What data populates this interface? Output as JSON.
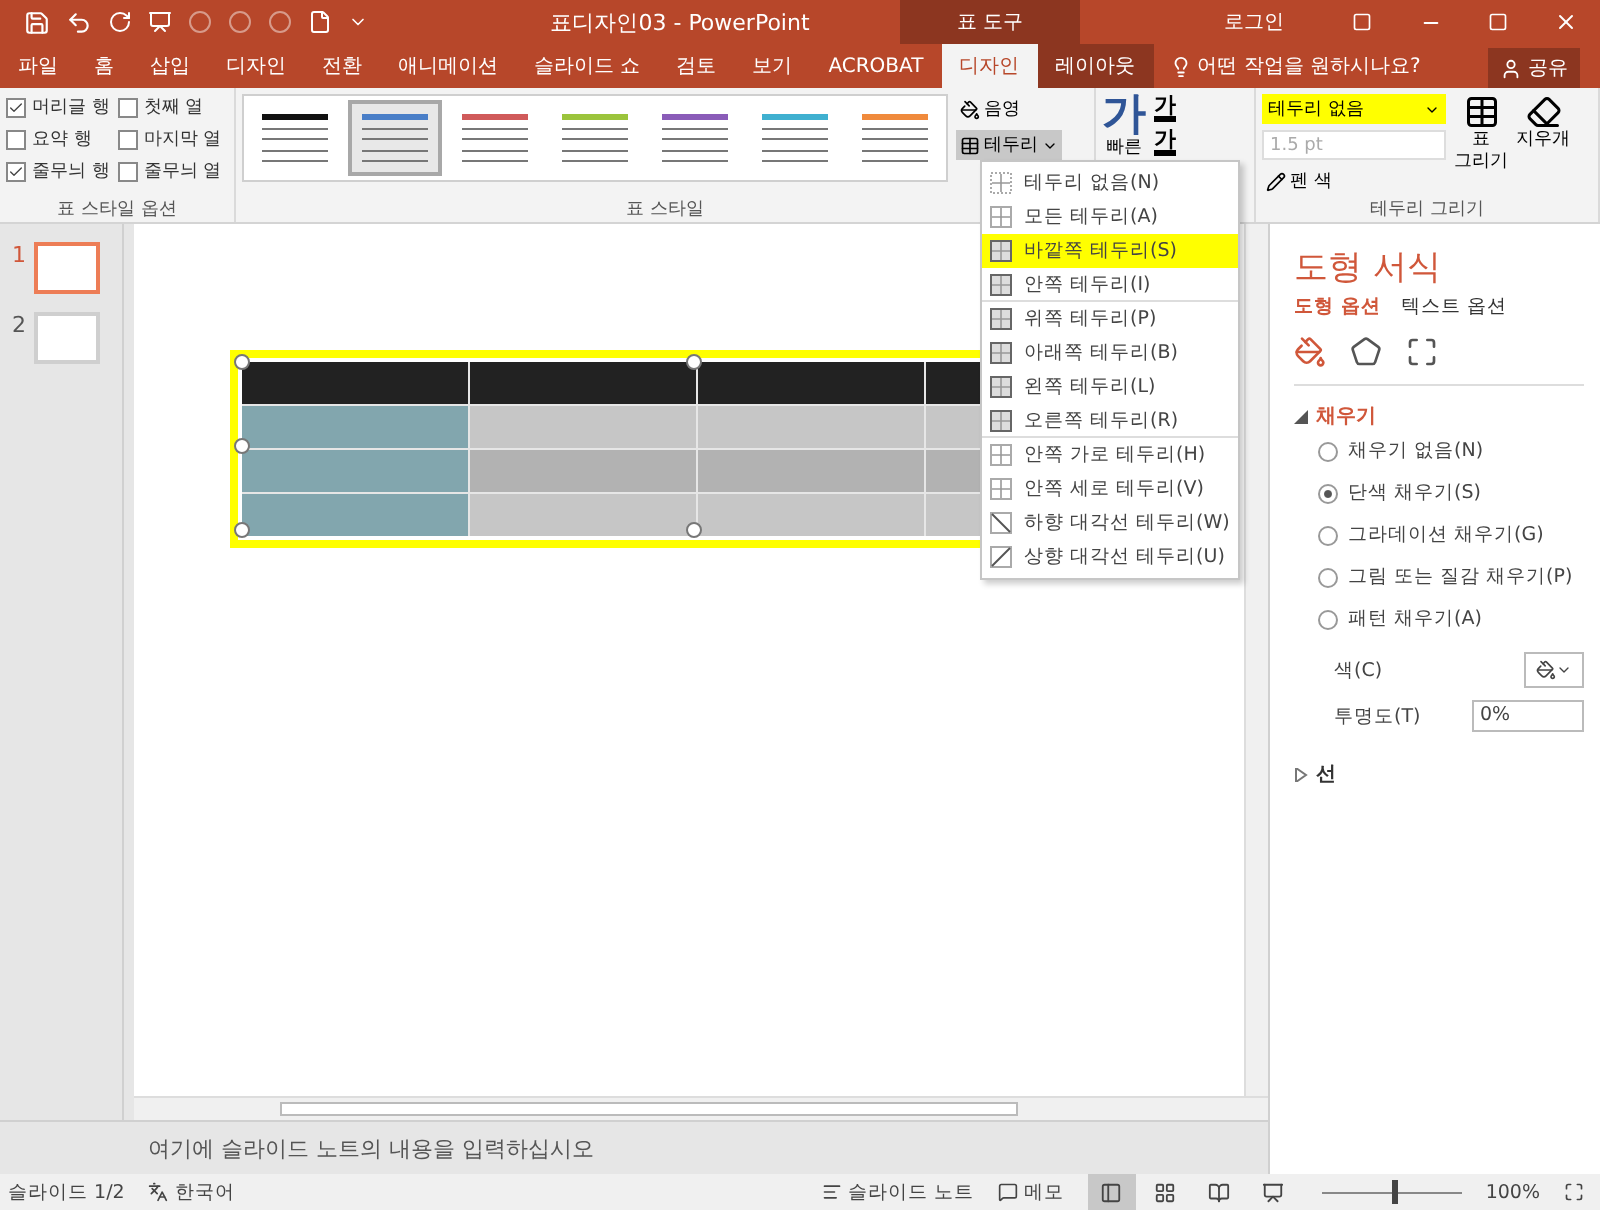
{
  "window": {
    "title": "표디자인03 - PowerPoint",
    "context_title": "표 도구",
    "signin": "로그인"
  },
  "tabs": [
    {
      "label": "파일",
      "selected": false,
      "contextual": false
    },
    {
      "label": "홈",
      "selected": false,
      "contextual": false
    },
    {
      "label": "삽입",
      "selected": false,
      "contextual": false
    },
    {
      "label": "디자인",
      "selected": false,
      "contextual": false
    },
    {
      "label": "전환",
      "selected": false,
      "contextual": false
    },
    {
      "label": "애니메이션",
      "selected": false,
      "contextual": false
    },
    {
      "label": "슬라이드 쇼",
      "selected": false,
      "contextual": false
    },
    {
      "label": "검토",
      "selected": false,
      "contextual": false
    },
    {
      "label": "보기",
      "selected": false,
      "contextual": false
    },
    {
      "label": "ACROBAT",
      "selected": false,
      "contextual": false
    },
    {
      "label": "디자인",
      "selected": true,
      "contextual": true
    },
    {
      "label": "레이아웃",
      "selected": false,
      "contextual": true
    }
  ],
  "tell_me": "어떤 작업을 원하시나요?",
  "share": "공유",
  "style_options": {
    "label": "표 스타일 옵션",
    "checkboxes": [
      {
        "label": "머리글 행",
        "checked": true
      },
      {
        "label": "요약 행",
        "checked": false
      },
      {
        "label": "줄무늬 행",
        "checked": true
      },
      {
        "label": "첫째 열",
        "checked": false
      },
      {
        "label": "마지막 열",
        "checked": false
      },
      {
        "label": "줄무늬 열",
        "checked": false
      }
    ]
  },
  "table_styles": {
    "label": "표 스타일",
    "swatches": [
      {
        "color": "#111111",
        "selected": false
      },
      {
        "color": "#4a7fc8",
        "selected": true
      },
      {
        "color": "#d05a5a",
        "selected": false
      },
      {
        "color": "#9bc43c",
        "selected": false
      },
      {
        "color": "#8a5cb8",
        "selected": false
      },
      {
        "color": "#3fb0d0",
        "selected": false
      },
      {
        "color": "#f08a3c",
        "selected": false
      }
    ],
    "shading": "음영",
    "borders": "테두리"
  },
  "quick_styles": {
    "label": "빠른",
    "glyphs": [
      "가",
      "가",
      "가"
    ]
  },
  "draw_borders": {
    "label": "테두리 그리기",
    "style": "테두리 없음",
    "weight": "1.5 pt",
    "pen_color": "펜 색",
    "draw_table": [
      "표",
      "그리기"
    ],
    "eraser": "지우개"
  },
  "border_menu": [
    {
      "label": "테두리 없음(N)",
      "selected": false,
      "group_end": false
    },
    {
      "label": "모든 테두리(A)",
      "selected": false,
      "group_end": false
    },
    {
      "label": "바깥쪽 테두리(S)",
      "selected": true,
      "group_end": false
    },
    {
      "label": "안쪽 테두리(I)",
      "selected": false,
      "group_end": true
    },
    {
      "label": "위쪽 테두리(P)",
      "selected": false,
      "group_end": false
    },
    {
      "label": "아래쪽 테두리(B)",
      "selected": false,
      "group_end": false
    },
    {
      "label": "왼쪽 테두리(L)",
      "selected": false,
      "group_end": false
    },
    {
      "label": "오른쪽 테두리(R)",
      "selected": false,
      "group_end": true
    },
    {
      "label": "안쪽 가로 테두리(H)",
      "selected": false,
      "group_end": false
    },
    {
      "label": "안쪽 세로 테두리(V)",
      "selected": false,
      "group_end": false
    },
    {
      "label": "하향 대각선 테두리(W)",
      "selected": false,
      "group_end": false
    },
    {
      "label": "상향 대각선 테두리(U)",
      "selected": false,
      "group_end": false
    }
  ],
  "slides": [
    {
      "number": "1",
      "selected": true
    },
    {
      "number": "2",
      "selected": false
    }
  ],
  "notes_placeholder": "여기에 슬라이드 노트의 내용을 입력하십시오",
  "format_pane": {
    "title": "도형 서식",
    "tabs": [
      {
        "label": "도형 옵션",
        "selected": true
      },
      {
        "label": "텍스트 옵션",
        "selected": false
      }
    ],
    "icon_tabs": [
      {
        "kind": "fill",
        "selected": true
      },
      {
        "kind": "shape",
        "selected": false
      },
      {
        "kind": "size",
        "selected": false
      }
    ],
    "fill_section": {
      "label": "채우기",
      "expanded": true
    },
    "fill_options": [
      {
        "label": "채우기 없음(N)",
        "selected": false
      },
      {
        "label": "단색 채우기(S)",
        "selected": true
      },
      {
        "label": "그라데이션 채우기(G)",
        "selected": false
      },
      {
        "label": "그림 또는 질감 채우기(P)",
        "selected": false
      },
      {
        "label": "패턴 채우기(A)",
        "selected": false
      }
    ],
    "color_label": "색(C)",
    "transparency_label": "투명도(T)",
    "transparency": "0%",
    "line_section": {
      "label": "선",
      "expanded": false
    }
  },
  "status_bar": {
    "slide": "슬라이드 1/2",
    "language": "한국어",
    "notes": "슬라이드 노트",
    "comments": "메모",
    "views": [
      {
        "kind": "normal",
        "selected": true
      },
      {
        "kind": "sorter",
        "selected": false
      },
      {
        "kind": "reading",
        "selected": false
      },
      {
        "kind": "show",
        "selected": false
      }
    ],
    "zoom": {
      "level": 0.5,
      "reading": "100%"
    }
  }
}
